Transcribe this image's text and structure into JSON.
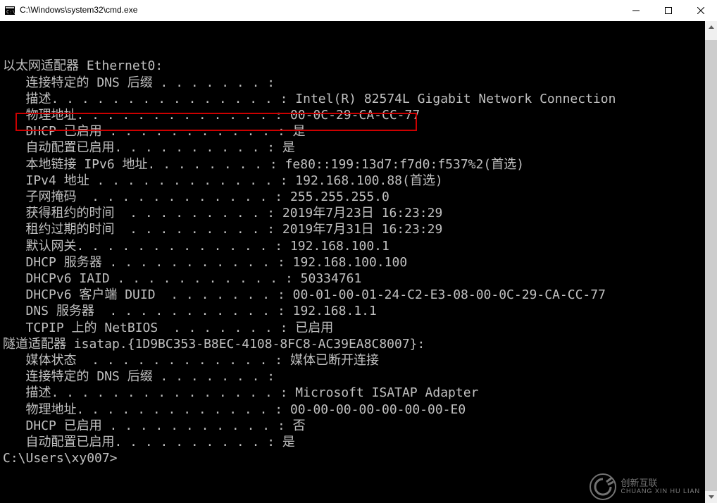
{
  "window": {
    "title": "C:\\Windows\\system32\\cmd.exe"
  },
  "terminal": {
    "lines": [
      "以太网适配器 Ethernet0:",
      "",
      "   连接特定的 DNS 后缀 . . . . . . . :",
      "   描述. . . . . . . . . . . . . . . : Intel(R) 82574L Gigabit Network Connection",
      "   物理地址. . . . . . . . . . . . . : 00-0C-29-CA-CC-77",
      "   DHCP 已启用 . . . . . . . . . . . : 是",
      "   自动配置已启用. . . . . . . . . . : 是",
      "   本地链接 IPv6 地址. . . . . . . . : fe80::199:13d7:f7d0:f537%2(首选)",
      "   IPv4 地址 . . . . . . . . . . . . : 192.168.100.88(首选)",
      "   子网掩码  . . . . . . . . . . . . : 255.255.255.0",
      "   获得租约的时间  . . . . . . . . . : 2019年7月23日 16:23:29",
      "   租约过期的时间  . . . . . . . . . : 2019年7月31日 16:23:29",
      "   默认网关. . . . . . . . . . . . . : 192.168.100.1",
      "   DHCP 服务器 . . . . . . . . . . . : 192.168.100.100",
      "   DHCPv6 IAID . . . . . . . . . . . : 50334761",
      "   DHCPv6 客户端 DUID  . . . . . . . : 00-01-00-01-24-C2-E3-08-00-0C-29-CA-CC-77",
      "   DNS 服务器  . . . . . . . . . . . : 192.168.1.1",
      "   TCPIP 上的 NetBIOS  . . . . . . . : 已启用",
      "",
      "隧道适配器 isatap.{1D9BC353-B8EC-4108-8FC8-AC39EA8C8007}:",
      "",
      "   媒体状态  . . . . . . . . . . . . : 媒体已断开连接",
      "   连接特定的 DNS 后缀 . . . . . . . :",
      "   描述. . . . . . . . . . . . . . . : Microsoft ISATAP Adapter",
      "   物理地址. . . . . . . . . . . . . : 00-00-00-00-00-00-00-E0",
      "   DHCP 已启用 . . . . . . . . . . . : 否",
      "   自动配置已启用. . . . . . . . . . : 是",
      "",
      "C:\\Users\\xy007>"
    ]
  },
  "watermark": {
    "main": "创新互联",
    "sub": "CHUANG XIN HU LIAN"
  }
}
